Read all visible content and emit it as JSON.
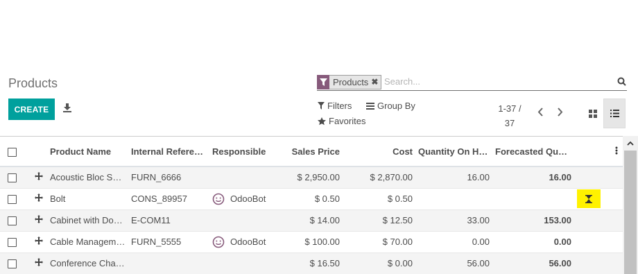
{
  "page": {
    "title": "Products"
  },
  "toolbar": {
    "create_label": "CREATE"
  },
  "search": {
    "facet_label": "Products",
    "facet_remove": "✖",
    "placeholder": "Search..."
  },
  "filters": {
    "filters_label": "Filters",
    "groupby_label": "Group By",
    "favorites_label": "Favorites"
  },
  "pager": {
    "range": "1-37 /",
    "total": "37"
  },
  "table": {
    "columns": [
      "Product Name",
      "Internal Refere…",
      "Responsible",
      "Sales Price",
      "Cost",
      "Quantity On Hand",
      "Forecasted Quan…"
    ],
    "rows": [
      {
        "name": "Acoustic Bloc Sc…",
        "ref": "FURN_6666",
        "responsible": "",
        "price": "$ 2,950.00",
        "cost": "$ 2,870.00",
        "on_hand": "16.00",
        "forecast": "16.00"
      },
      {
        "name": "Bolt",
        "ref": "CONS_89957",
        "responsible": "OdooBot",
        "price": "$ 0.50",
        "cost": "$ 0.50",
        "on_hand": "",
        "forecast": ""
      },
      {
        "name": "Cabinet with Doo…",
        "ref": "E-COM11",
        "responsible": "",
        "price": "$ 14.00",
        "cost": "$ 12.50",
        "on_hand": "33.00",
        "forecast": "153.00"
      },
      {
        "name": "Cable Managem…",
        "ref": "FURN_5555",
        "responsible": "OdooBot",
        "price": "$ 100.00",
        "cost": "$ 70.00",
        "on_hand": "0.00",
        "forecast": "0.00"
      },
      {
        "name": "Conference Chai…",
        "ref": "",
        "responsible": "",
        "price": "$ 16.50",
        "cost": "$ 0.00",
        "on_hand": "56.00",
        "forecast": "56.00"
      }
    ]
  },
  "colors": {
    "accent": "#00a09d",
    "facet": "#875a7b",
    "highlight": "#fff200"
  }
}
